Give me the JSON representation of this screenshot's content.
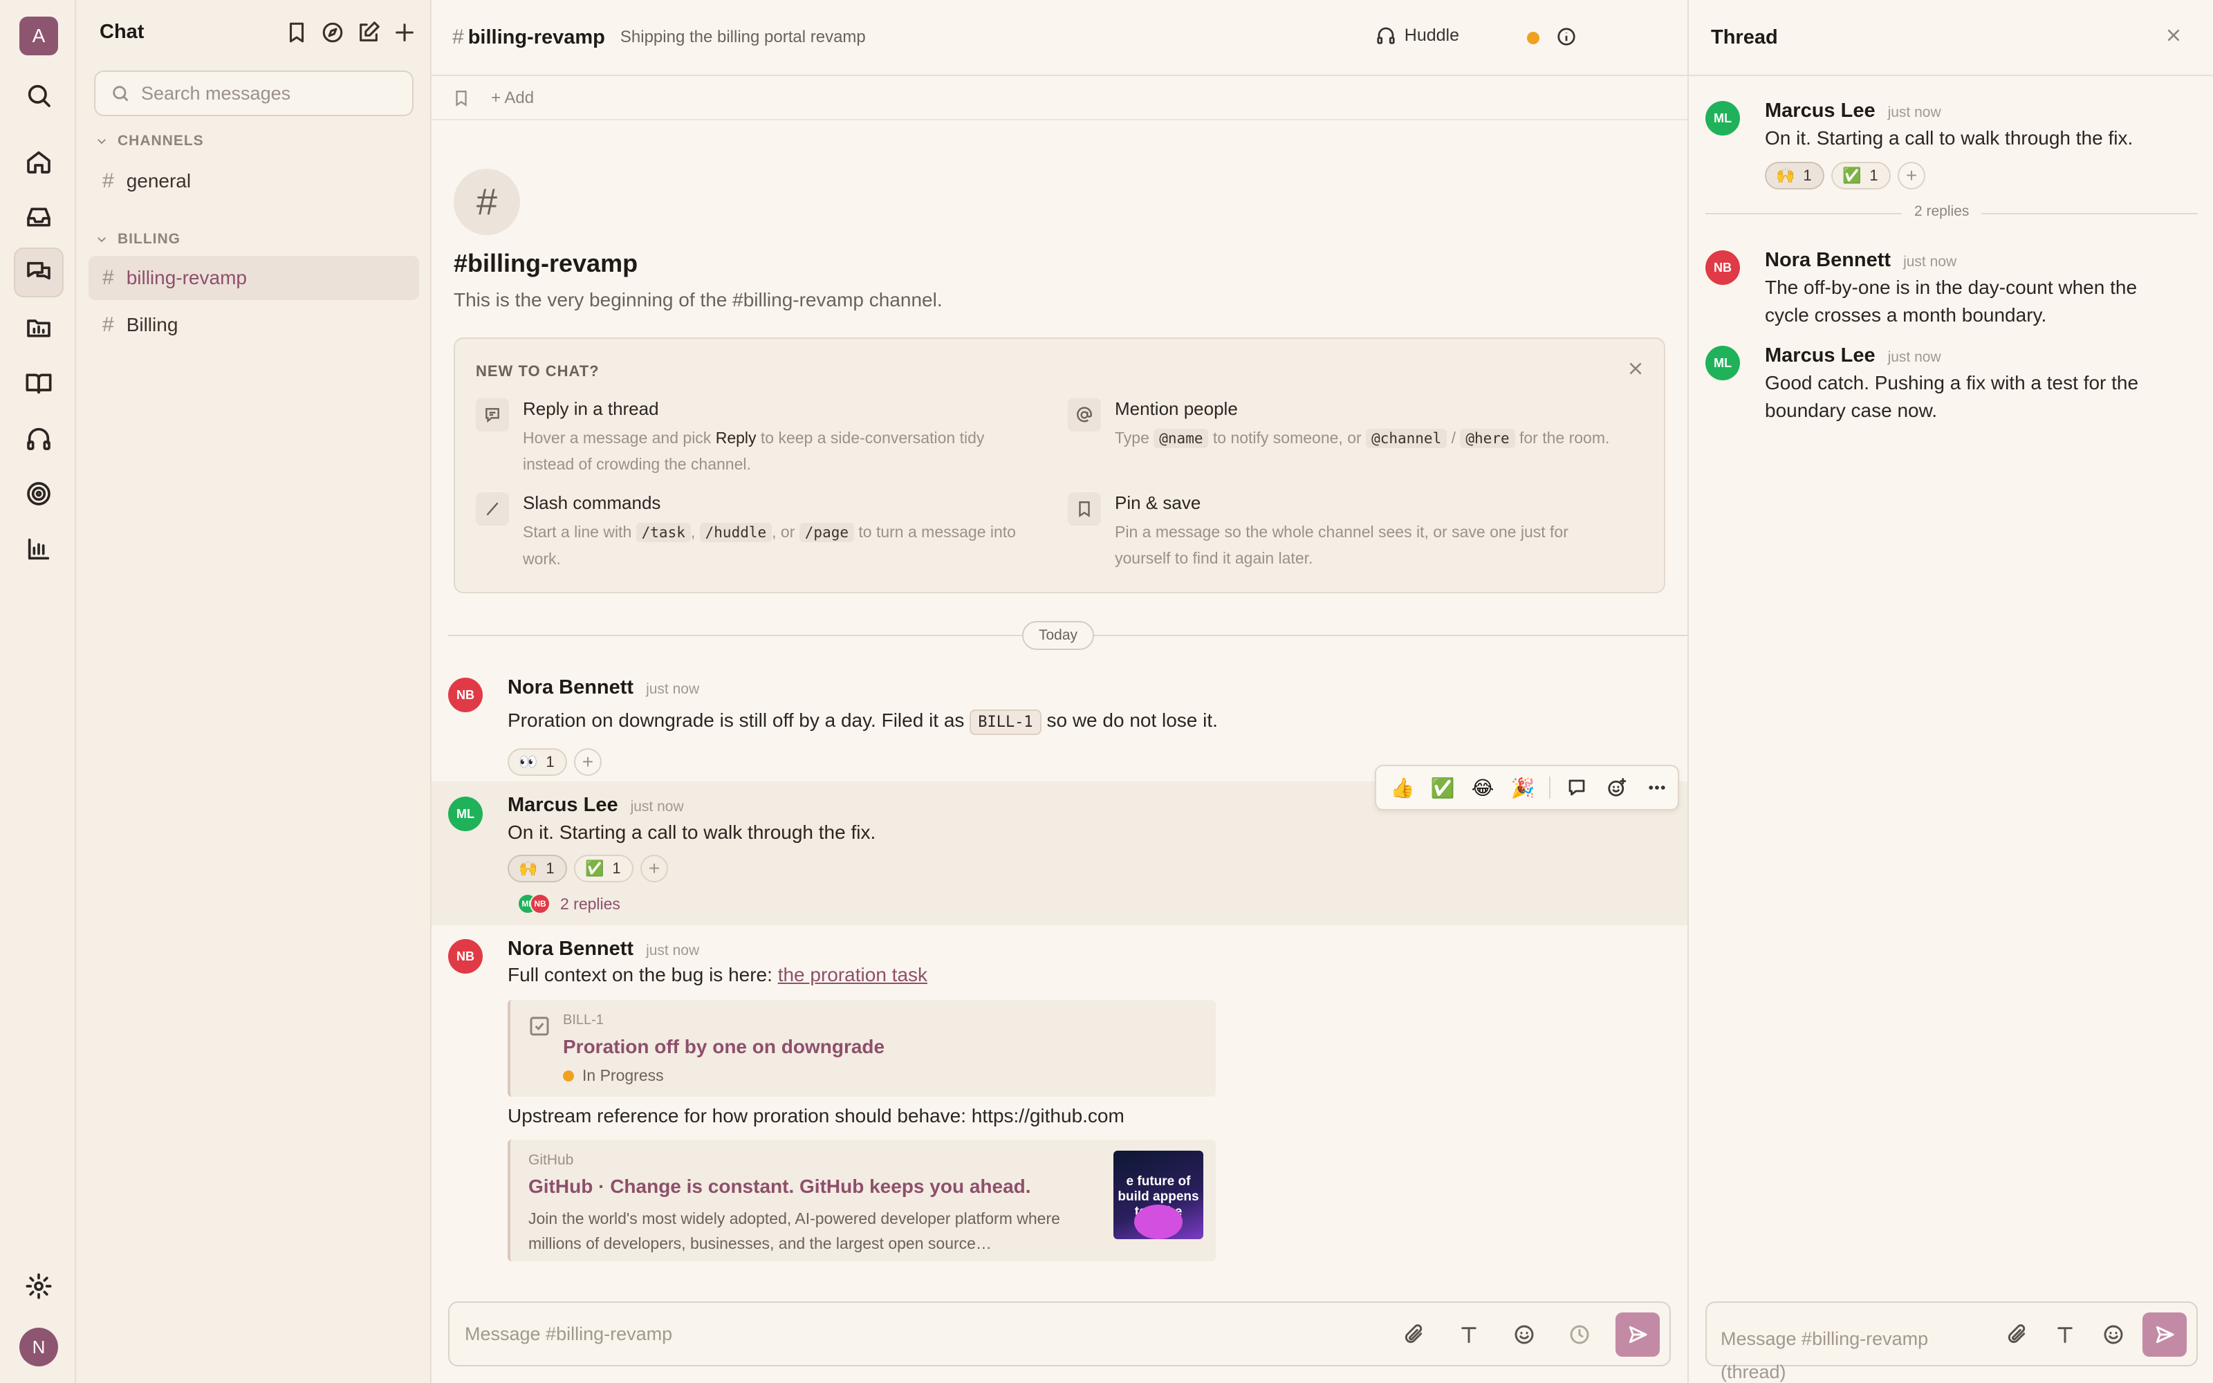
{
  "workspace": {
    "initial": "A",
    "user_initial": "N"
  },
  "sidebar": {
    "title": "Chat",
    "search_placeholder": "Search messages",
    "sections": [
      {
        "label": "CHANNELS",
        "channels": [
          "general"
        ]
      },
      {
        "label": "BILLING",
        "channels": [
          "billing-revamp",
          "Billing"
        ]
      }
    ],
    "active_channel": "billing-revamp"
  },
  "channel": {
    "hash": "#",
    "name": "billing-revamp",
    "topic": "Shipping the billing portal revamp",
    "huddle_label": "Huddle",
    "add_label": "Add",
    "intro_title": "#billing-revamp",
    "intro_subtitle": "This is the very beginning of the #billing-revamp channel."
  },
  "onboarding": {
    "title": "NEW TO CHAT?",
    "tips": [
      {
        "title": "Reply in a thread",
        "d1": "Hover a message and pick ",
        "d2": "Reply",
        "d3": " to keep a side-conversation tidy instead of crowding the channel."
      },
      {
        "title": "Mention people",
        "d1": "Type ",
        "c1": "@name",
        "d2": " to notify someone, or ",
        "c2": "@channel",
        "d3": " / ",
        "c3": "@here",
        "d4": " for the room."
      },
      {
        "title": "Slash commands",
        "d1": "Start a line with ",
        "c1": "/task",
        "d2": ", ",
        "c2": "/huddle",
        "d3": ", or ",
        "c3": "/page",
        "d4": " to turn a message into work."
      },
      {
        "title": "Pin & save",
        "d1": "Pin a message so the whole channel sees it, or save one just for yourself to find it again later."
      }
    ]
  },
  "day_separator": "Today",
  "messages": [
    {
      "initials": "NB",
      "author": "Nora Bennett",
      "time": "just now",
      "t1": "Proration on downgrade is still off by a day. Filed it as ",
      "tag": "BILL-1",
      "t2": " so we do not lose it.",
      "reactions": [
        {
          "emoji": "👀",
          "count": "1"
        }
      ]
    },
    {
      "initials": "ML",
      "author": "Marcus Lee",
      "time": "just now",
      "text": "On it. Starting a call to walk through the fix.",
      "reactions": [
        {
          "emoji": "🙌",
          "count": "1"
        },
        {
          "emoji": "✅",
          "count": "1"
        }
      ],
      "replies_label": "2 replies",
      "reply_avatars": [
        "ML",
        "NB"
      ]
    },
    {
      "initials": "NB",
      "author": "Nora Bennett",
      "time": "just now",
      "t1": "Full context on the bug is here: ",
      "link": "the proration task",
      "task": {
        "id": "BILL-1",
        "title": "Proration off by one on downgrade",
        "status": "In Progress"
      },
      "t2": "Upstream reference for how proration should behave: https://github.com",
      "preview": {
        "source": "GitHub",
        "title": "GitHub · Change is constant. GitHub keeps you ahead.",
        "desc": "Join the world's most widely adopted, AI-powered developer platform where millions of developers, businesses, and the largest open source…",
        "image_text": "e future of build appens togethe"
      }
    }
  ],
  "hover_toolbar": {
    "emojis": [
      "👍",
      "✅",
      "😂",
      "🎉"
    ]
  },
  "composer": {
    "placeholder": "Message #billing-revamp"
  },
  "thread": {
    "title": "Thread",
    "replies_label": "2 replies",
    "thread_composer_placeholder": "Message #billing-revamp (thread)",
    "parent": {
      "initials": "ML",
      "author": "Marcus Lee",
      "time": "just now",
      "text": "On it. Starting a call to walk through the fix.",
      "reactions": [
        {
          "emoji": "🙌",
          "count": "1"
        },
        {
          "emoji": "✅",
          "count": "1"
        }
      ]
    },
    "replies": [
      {
        "initials": "NB",
        "author": "Nora Bennett",
        "time": "just now",
        "text": "The off-by-one is in the day-count when the cycle crosses a month boundary."
      },
      {
        "initials": "ML",
        "author": "Marcus Lee",
        "time": "just now",
        "text": "Good catch. Pushing a fix with a test for the boundary case now."
      }
    ]
  },
  "colors": {
    "accent": "#8e4f6c",
    "avatar_red": "#e03a46",
    "avatar_green": "#1fb25a",
    "status_orange": "#f2a020"
  }
}
